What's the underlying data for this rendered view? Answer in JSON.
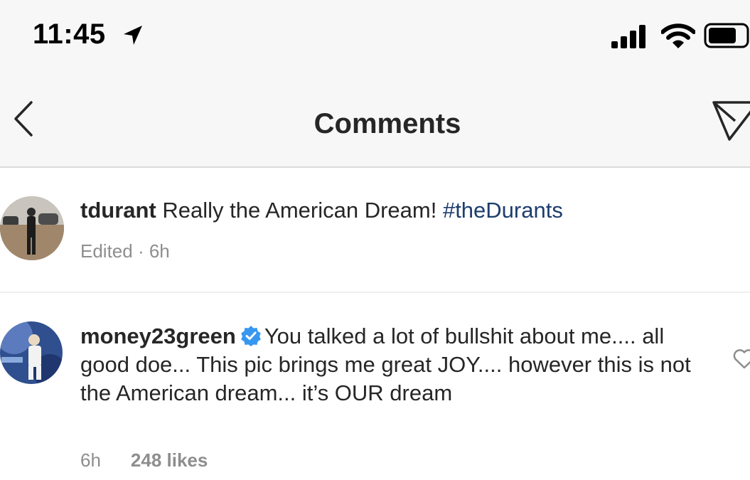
{
  "status_bar": {
    "time": "11:45",
    "icons": [
      "location-arrow-icon",
      "signal-bars-icon",
      "wifi-icon",
      "battery-icon"
    ]
  },
  "nav": {
    "title": "Comments",
    "back_icon": "chevron-left-icon",
    "share_icon": "paper-plane-icon"
  },
  "caption": {
    "username": "tdurant",
    "text": "Really the American Dream!",
    "hashtag": "#theDurants",
    "meta": "Edited · 6h"
  },
  "comment": {
    "username": "money23green",
    "verified": true,
    "text": "You talked a lot of bullshit about me.... all good doe... This pic brings me great JOY.... however this is not the American dream... it’s OUR dream",
    "time": "6h",
    "likes": "248 likes"
  },
  "colors": {
    "bar_background": "#f7f7f7",
    "text": "#262626",
    "secondary_text": "#8e8e8e",
    "hashtag": "#1d3d6e",
    "verified_badge": "#3897f0"
  }
}
